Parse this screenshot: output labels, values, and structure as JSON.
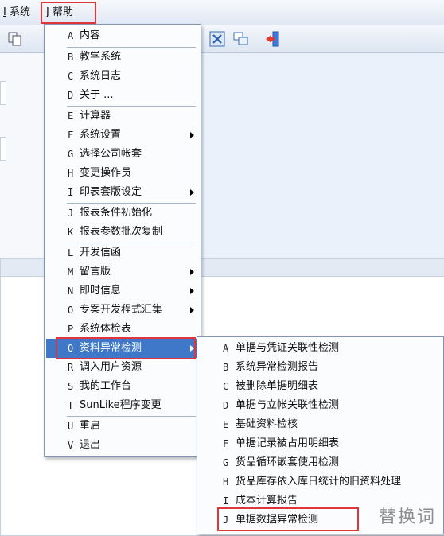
{
  "menubar": {
    "items": [
      {
        "key": "I",
        "label": "系统"
      },
      {
        "key": "J",
        "label": "帮助"
      }
    ]
  },
  "toolbar": {
    "icons": [
      "copy-icon",
      "close-window-icon",
      "cascade-windows-icon",
      "exit-icon"
    ]
  },
  "help_menu": {
    "items": [
      {
        "key": "A",
        "label": "内容"
      },
      {
        "key": "B",
        "label": "教学系统"
      },
      {
        "key": "C",
        "label": "系统日志"
      },
      {
        "key": "D",
        "label": "关于 ..."
      },
      {
        "key": "E",
        "label": "计算器"
      },
      {
        "key": "F",
        "label": "系统设置"
      },
      {
        "key": "G",
        "label": "选择公司帐套"
      },
      {
        "key": "H",
        "label": "变更操作员"
      },
      {
        "key": "I",
        "label": "印表套版设定"
      },
      {
        "key": "J",
        "label": "报表条件初始化"
      },
      {
        "key": "K",
        "label": "报表参数批次复制"
      },
      {
        "key": "L",
        "label": "开发信函"
      },
      {
        "key": "M",
        "label": "留言版"
      },
      {
        "key": "N",
        "label": "即时信息"
      },
      {
        "key": "O",
        "label": "专案开发程式汇集"
      },
      {
        "key": "P",
        "label": "系统体检表"
      },
      {
        "key": "Q",
        "label": "资料异常检测"
      },
      {
        "key": "R",
        "label": "调入用户资源"
      },
      {
        "key": "S",
        "label": "我的工作台"
      },
      {
        "key": "T",
        "label": "SunLike程序变更"
      },
      {
        "key": "U",
        "label": "重启"
      },
      {
        "key": "V",
        "label": "退出"
      }
    ]
  },
  "submenu": {
    "items": [
      {
        "key": "A",
        "label": "单据与凭证关联性检测"
      },
      {
        "key": "B",
        "label": "系统异常检测报告"
      },
      {
        "key": "C",
        "label": "被删除单据明细表"
      },
      {
        "key": "D",
        "label": "单据与立帐关联性检测"
      },
      {
        "key": "E",
        "label": "基础资料检核"
      },
      {
        "key": "F",
        "label": "单据记录被占用明细表"
      },
      {
        "key": "G",
        "label": "货品循环嵌套使用检测"
      },
      {
        "key": "H",
        "label": "货品库存依入库日统计的旧资料处理"
      },
      {
        "key": "I",
        "label": "成本计算报告"
      },
      {
        "key": "J",
        "label": "单据数据异常检测"
      }
    ]
  },
  "watermark": "替换词"
}
